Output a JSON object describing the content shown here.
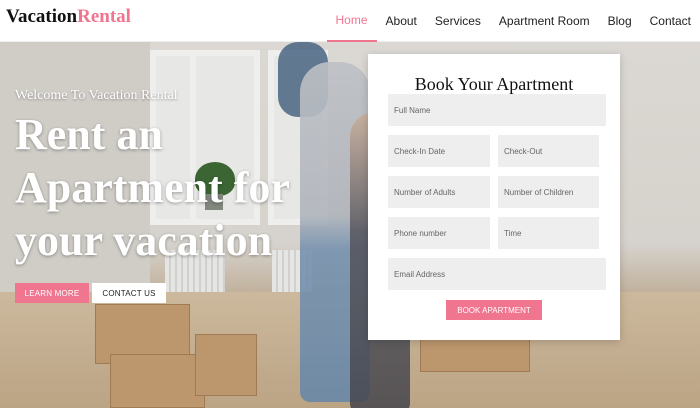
{
  "header": {
    "logo_part1": "Vacation",
    "logo_part2": "Rental",
    "nav": [
      "Home",
      "About",
      "Services",
      "Apartment Room",
      "Blog",
      "Contact"
    ],
    "active_nav": "Home"
  },
  "hero": {
    "welcome": "Welcome To Vacation Rental",
    "headline": "Rent an Apartment for your vacation",
    "learn_more": "LEARN MORE",
    "contact_us": "CONTACT US"
  },
  "booking": {
    "title": "Book Your Apartment",
    "fields": {
      "full_name": "Full Name",
      "check_in": "Check-In Date",
      "check_out": "Check-Out",
      "adults": "Number of Adults",
      "children": "Number of Children",
      "phone": "Phone number",
      "time": "Time",
      "email": "Email Address"
    },
    "submit": "BOOK APARTMENT"
  },
  "colors": {
    "accent": "#f0758f",
    "field_bg": "#eeeeee"
  }
}
